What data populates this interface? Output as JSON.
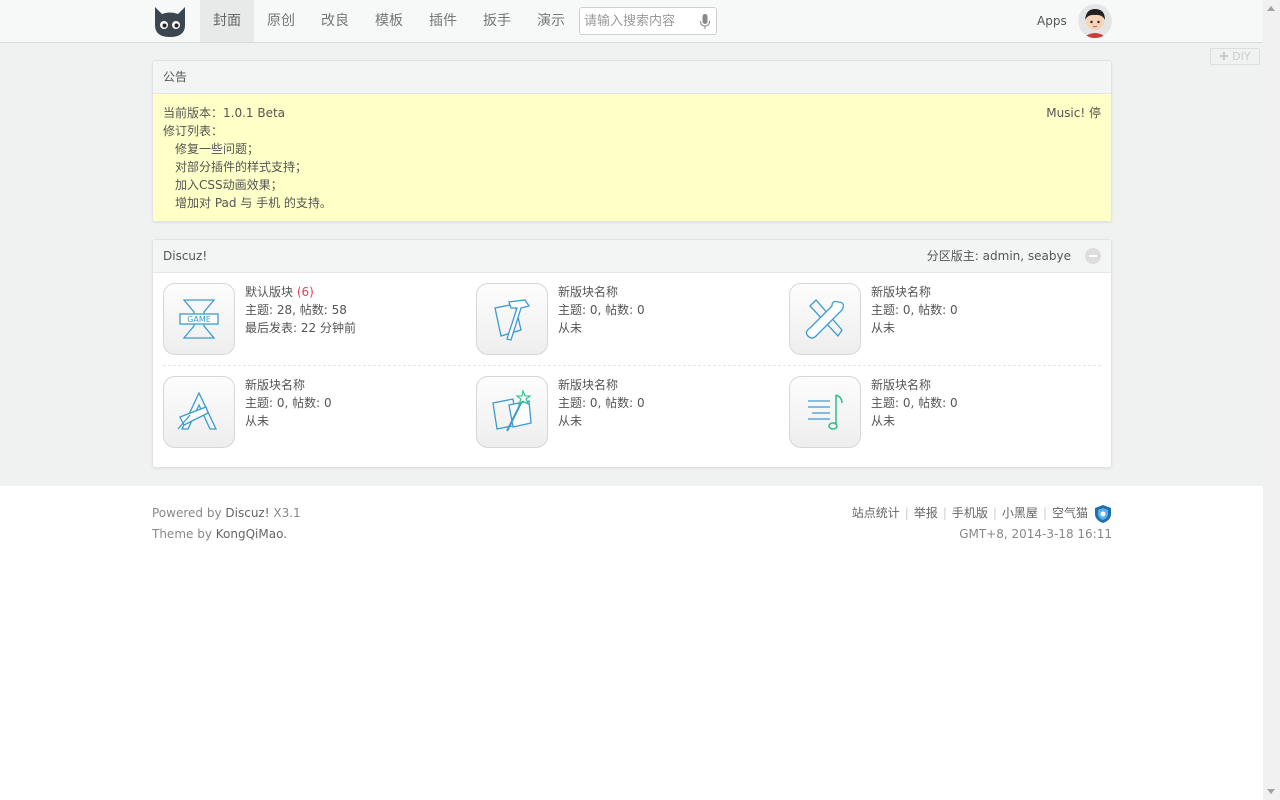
{
  "nav": {
    "items": [
      "封面",
      "原创",
      "改良",
      "模板",
      "插件",
      "扳手",
      "演示"
    ],
    "search_placeholder": "请输入搜索内容",
    "apps_label": "Apps"
  },
  "diy_label": "✚ DIY",
  "notice": {
    "title": "公告",
    "version": "当前版本：1.0.1 Beta",
    "changelog_title": "修订列表：",
    "changes": [
      "修复一些问题；",
      "对部分插件的样式支持；",
      "加入CSS动画效果；",
      "增加对 Pad 与 手机 的支持。"
    ],
    "music_label": "Music! 停"
  },
  "forum": {
    "title": "Discuz!",
    "moderators_label": "分区版主:",
    "moderators": "admin, seabye",
    "boards": [
      {
        "icon": "game-icon",
        "name": "默认版块",
        "today": "(6)",
        "stats": "主题: 28, 帖数: 58",
        "last": "最后发表: 22 分钟前"
      },
      {
        "icon": "hammer-icon",
        "name": "新版块名称",
        "today": "",
        "stats": "主题: 0, 帖数: 0",
        "last": "从未"
      },
      {
        "icon": "tools-icon",
        "name": "新版块名称",
        "today": "",
        "stats": "主题: 0, 帖数: 0",
        "last": "从未"
      },
      {
        "icon": "drafting-icon",
        "name": "新版块名称",
        "today": "",
        "stats": "主题: 0, 帖数: 0",
        "last": "从未"
      },
      {
        "icon": "magic-wand-icon",
        "name": "新版块名称",
        "today": "",
        "stats": "主题: 0, 帖数: 0",
        "last": "从未"
      },
      {
        "icon": "music-note-icon",
        "name": "新版块名称",
        "today": "",
        "stats": "主题: 0, 帖数: 0",
        "last": "从未"
      }
    ]
  },
  "footer": {
    "powered_prefix": "Powered by",
    "powered_name": "Discuz!",
    "powered_version": "X3.1",
    "theme_prefix": "Theme by",
    "theme_name": "KongQiMao.",
    "links": [
      "站点统计",
      "举报",
      "手机版",
      "小黑屋",
      "空气猫"
    ],
    "time": "GMT+8, 2014-3-18 16:11"
  },
  "colors": {
    "notice_bg": "#ffffc8",
    "accent_icon": "#3a9bd0",
    "today_count": "#e0405a"
  }
}
